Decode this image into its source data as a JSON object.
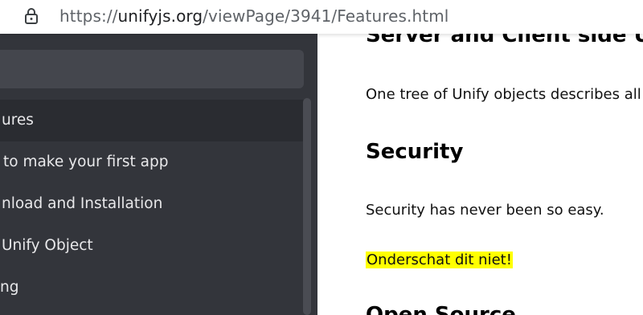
{
  "browser": {
    "url_prefix": "https://",
    "url_domain": "unifyjs.org",
    "url_path": "/viewPage/3941/Features.html"
  },
  "sidebar": {
    "items": [
      {
        "label": "ures",
        "active": true
      },
      {
        "label": "to make your first app",
        "active": false
      },
      {
        "label": "nload and Installation",
        "active": false
      },
      {
        "label": "Unify Object",
        "active": false
      },
      {
        "label": "ng",
        "active": false
      }
    ]
  },
  "content": {
    "heading_top": "Server and Client side Un",
    "paragraph_1": "One tree of Unify objects describes all yo",
    "heading_security": "Security",
    "paragraph_security": "Security has never been so easy.",
    "highlight_text": "Onderschat dit niet!",
    "heading_open_source": "Open Source"
  },
  "colors": {
    "sidebar_bg": "#33353b",
    "highlight": "#ffff00"
  }
}
